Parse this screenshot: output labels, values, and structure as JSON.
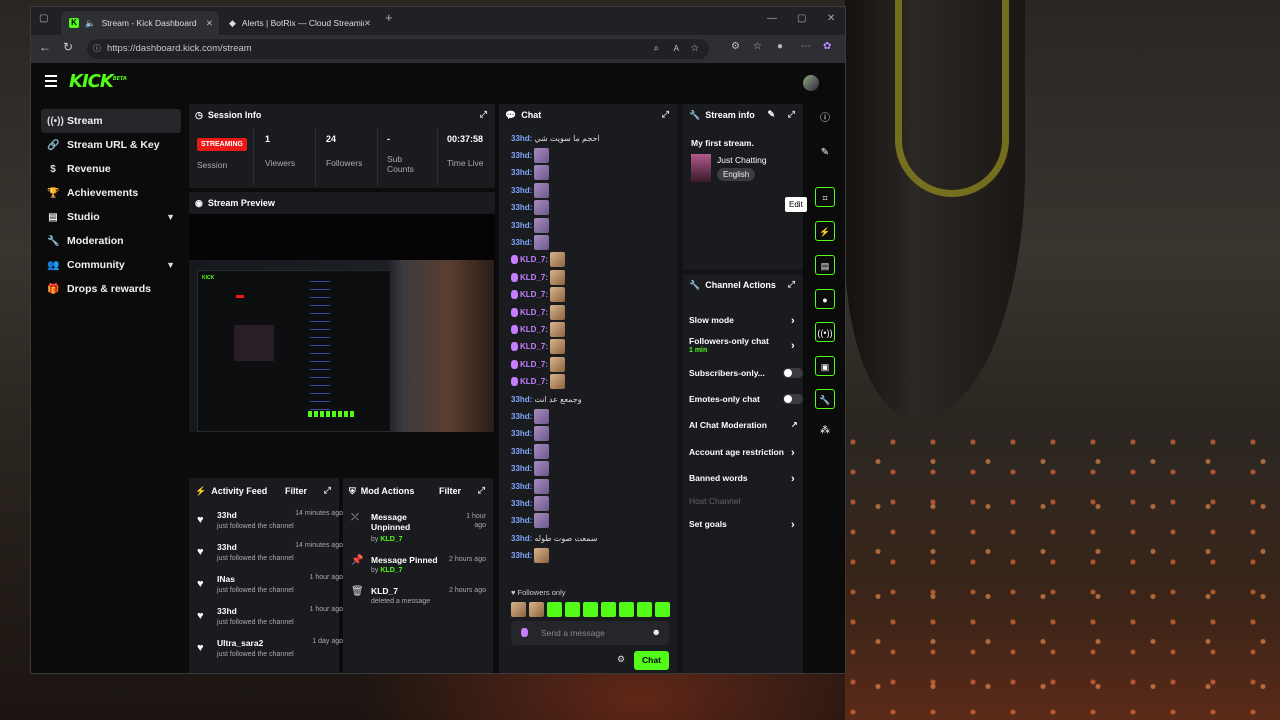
{
  "browser": {
    "tabs": [
      {
        "title": "Stream - Kick Dashboard"
      },
      {
        "title": "Alerts | BotRix — Cloud Streaming"
      }
    ],
    "url": "https://dashboard.kick.com/stream"
  },
  "app": {
    "logo": "KICK",
    "logo_sup": "BETA"
  },
  "sidebar": {
    "items": [
      {
        "label": "Stream",
        "icon": "broadcast-icon"
      },
      {
        "label": "Stream URL & Key",
        "icon": "link-icon"
      },
      {
        "label": "Revenue",
        "icon": "dollar-icon"
      },
      {
        "label": "Achievements",
        "icon": "trophy-icon"
      },
      {
        "label": "Studio",
        "icon": "studio-icon"
      },
      {
        "label": "Moderation",
        "icon": "wrench-icon"
      },
      {
        "label": "Community",
        "icon": "people-icon"
      },
      {
        "label": "Drops & rewards",
        "icon": "gift-icon"
      }
    ]
  },
  "session": {
    "title": "Session Info",
    "badge": "STREAMING",
    "session_label": "Session",
    "viewers_value": "1",
    "viewers_label": "Viewers",
    "followers_value": "24",
    "followers_label": "Followers",
    "subs_value": "-",
    "subs_label_1": "Sub",
    "subs_label_2": "Counts",
    "time_value": "00:37:58",
    "time_label": "Time Live"
  },
  "preview": {
    "title": "Stream Preview"
  },
  "activity": {
    "title": "Activity Feed",
    "filter": "Filter",
    "items": [
      {
        "name": "33hd",
        "desc": "just followed the channel",
        "time": "14 minutes ago"
      },
      {
        "name": "33hd",
        "desc": "just followed the channel",
        "time": "14 minutes ago"
      },
      {
        "name": "INas",
        "desc": "just followed the channel",
        "time": "1 hour ago"
      },
      {
        "name": "33hd",
        "desc": "just followed the channel",
        "time": "1 hour ago"
      },
      {
        "name": "Ultra_sara2",
        "desc": "just followed the channel",
        "time": "1 day ago"
      }
    ]
  },
  "mod_actions": {
    "title": "Mod Actions",
    "filter": "Filter",
    "items": [
      {
        "action_1": "Message",
        "action_2": "Unpinned",
        "by_prefix": "by",
        "by": "KLD_7",
        "time_1": "1 hour",
        "time_2": "ago"
      },
      {
        "action_1": "Message Pinned",
        "action_2": "",
        "by_prefix": "by",
        "by": "KLD_7",
        "time_1": "2 hours ago",
        "time_2": ""
      },
      {
        "action_1": "KLD_7",
        "action_2": "",
        "desc": "deleted a message",
        "time_1": "2 hours ago",
        "time_2": ""
      }
    ]
  },
  "chat": {
    "title": "Chat",
    "messages": [
      {
        "user": "33hd:",
        "text": "احجم ما سويت شي",
        "emote": "none"
      },
      {
        "user": "33hd:",
        "text": "",
        "emote": "purple"
      },
      {
        "user": "33hd:",
        "text": "",
        "emote": "purple"
      },
      {
        "user": "33hd:",
        "text": "",
        "emote": "purple"
      },
      {
        "user": "33hd:",
        "text": "",
        "emote": "purple"
      },
      {
        "user": "33hd:",
        "text": "",
        "emote": "purple"
      },
      {
        "user": "33hd:",
        "text": "",
        "emote": "purple"
      },
      {
        "user": "KLD_7:",
        "text": "",
        "emote": "cat"
      },
      {
        "user": "KLD_7:",
        "text": "",
        "emote": "cat"
      },
      {
        "user": "KLD_7:",
        "text": "",
        "emote": "cat"
      },
      {
        "user": "KLD_7:",
        "text": "",
        "emote": "cat"
      },
      {
        "user": "KLD_7:",
        "text": "",
        "emote": "cat"
      },
      {
        "user": "KLD_7:",
        "text": "",
        "emote": "cat"
      },
      {
        "user": "KLD_7:",
        "text": "",
        "emote": "cat"
      },
      {
        "user": "KLD_7:",
        "text": "",
        "emote": "cat"
      },
      {
        "user": "33hd:",
        "text": "وجمعع عد انت",
        "emote": "none"
      },
      {
        "user": "33hd:",
        "text": "",
        "emote": "purple"
      },
      {
        "user": "33hd:",
        "text": "",
        "emote": "purple"
      },
      {
        "user": "33hd:",
        "text": "",
        "emote": "purple"
      },
      {
        "user": "33hd:",
        "text": "",
        "emote": "purple"
      },
      {
        "user": "33hd:",
        "text": "",
        "emote": "purple"
      },
      {
        "user": "33hd:",
        "text": "",
        "emote": "purple"
      },
      {
        "user": "33hd:",
        "text": "",
        "emote": "purple"
      },
      {
        "user": "33hd:",
        "text": "سمعت صوت طوله",
        "emote": "none"
      },
      {
        "user": "33hd:",
        "text": "",
        "emote": "cat"
      }
    ],
    "followers_only": "Followers only",
    "placeholder": "Send a message",
    "send_label": "Chat"
  },
  "stream_info": {
    "title": "Stream info",
    "stream_title": "My first stream.",
    "category": "Just Chatting",
    "language": "English",
    "tooltip": "Edit"
  },
  "channel_actions": {
    "title": "Channel Actions",
    "rows": [
      {
        "label": "Slow mode",
        "sub": ""
      },
      {
        "label": "Followers-only chat",
        "sub": "1 min"
      },
      {
        "label": "Subscribers-only...",
        "sub": ""
      },
      {
        "label": "Emotes-only chat",
        "sub": ""
      },
      {
        "label": "AI Chat Moderation",
        "sub": ""
      },
      {
        "label": "Account age restriction",
        "sub": ""
      },
      {
        "label": "Banned words",
        "sub": ""
      },
      {
        "label": "Host Channel",
        "sub": ""
      },
      {
        "label": "Set goals",
        "sub": ""
      }
    ]
  },
  "colors": {
    "accent": "#53fc18",
    "streaming": "#e91916",
    "panel": "#191b1e"
  }
}
